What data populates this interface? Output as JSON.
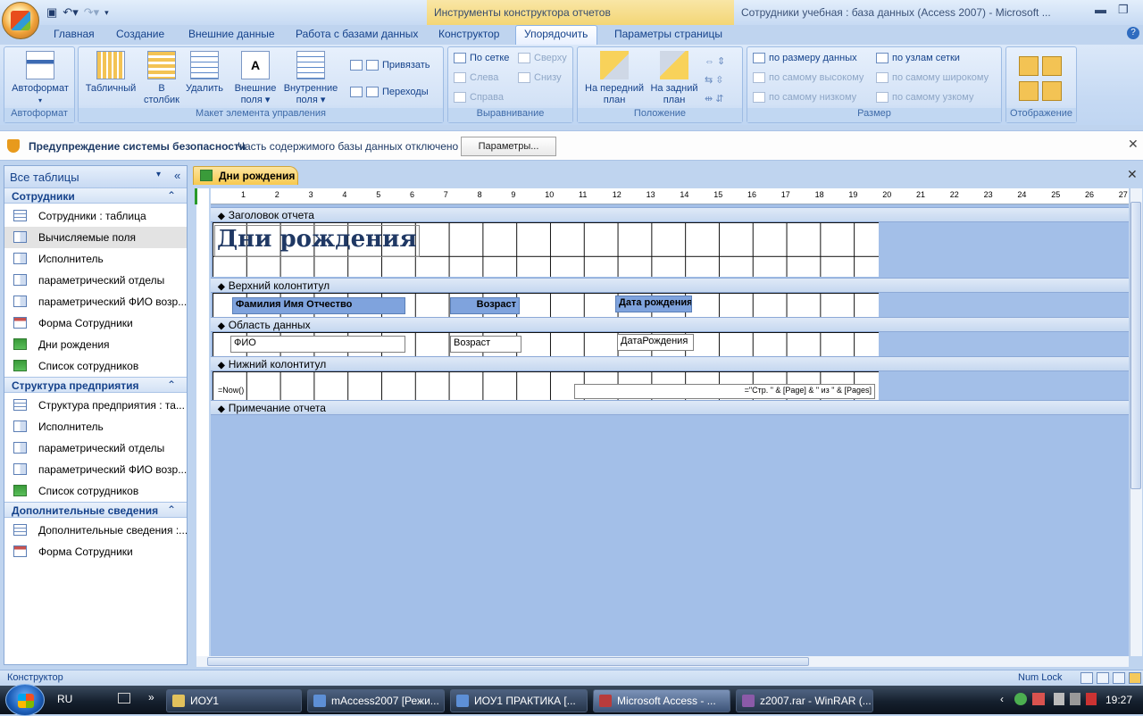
{
  "ribbon_context": "Инструменты конструктора отчетов",
  "window_title": "Сотрудники учебная : база данных (Access 2007) - Microsoft ...",
  "tabs": [
    "Главная",
    "Создание",
    "Внешние данные",
    "Работа с базами данных",
    "Конструктор",
    "Упорядочить",
    "Параметры страницы"
  ],
  "groups": {
    "autoformat": {
      "label": "Автоформат",
      "btn": "Автоформат"
    },
    "layout": {
      "label": "Макет элемента управления",
      "tabular": "Табличный",
      "stacked1": "В",
      "stacked2": "столбик",
      "remove": "Удалить",
      "outer1": "Внешние",
      "outer2": "поля",
      "inner1": "Внутренние",
      "inner2": "поля",
      "bind": "Привязать",
      "jumps": "Переходы"
    },
    "align": {
      "label": "Выравнивание",
      "grid": "По сетке",
      "top": "Сверху",
      "left": "Слева",
      "bottom": "Снизу",
      "right": "Справа"
    },
    "position": {
      "label": "Положение",
      "front1": "На передний",
      "front2": "план",
      "back1": "На задний",
      "back2": "план"
    },
    "size": {
      "label": "Размер",
      "fit": "по размеру данных",
      "to_grid": "по узлам сетки",
      "tallest": "по самому высокому",
      "widest": "по самому широкому",
      "shortest": "по самому низкому",
      "narrowest": "по самому узкому"
    },
    "show": {
      "label": "Отображение"
    }
  },
  "security": {
    "title": "Предупреждение системы безопасности",
    "text": "Часть содержимого базы данных отключено",
    "button": "Параметры..."
  },
  "nav": {
    "header": "Все таблицы",
    "sections": [
      {
        "title": "Сотрудники",
        "items": [
          "Сотрудники : таблица",
          "Вычисляемые поля",
          "Исполнитель",
          "параметрический отделы",
          "параметрический ФИО возр...",
          "Форма Сотрудники",
          "Дни рождения",
          "Список сотрудников"
        ]
      },
      {
        "title": "Структура предприятия",
        "items": [
          "Структура предприятия : та...",
          "Исполнитель",
          "параметрический отделы",
          "параметрический ФИО возр...",
          "Список сотрудников"
        ]
      },
      {
        "title": "Дополнительные сведения",
        "items": [
          "Дополнительные сведения :...",
          "Форма Сотрудники"
        ]
      }
    ]
  },
  "doc_tab": "Дни рождения",
  "ruler": [
    "1",
    "2",
    "3",
    "4",
    "5",
    "6",
    "7",
    "8",
    "9",
    "10",
    "11",
    "12",
    "13",
    "14",
    "15",
    "16",
    "17",
    "18",
    "19",
    "20",
    "21",
    "22",
    "23",
    "24",
    "25",
    "26",
    "27"
  ],
  "sections": {
    "report_header": "Заголовок отчета",
    "page_header": "Верхний колонтитул",
    "detail": "Область данных",
    "page_footer": "Нижний колонтитул",
    "report_footer": "Примечание отчета"
  },
  "controls": {
    "title": "Дни рождения",
    "lbl_fio": "Фамилия Имя Отчество",
    "lbl_age": "Возраст",
    "lbl_dob": "Дата рождения",
    "fld_fio": "ФИО",
    "fld_age": "Возраст",
    "fld_dob": "ДатаРождения",
    "now": "=Now()",
    "pages": "=\"Стр. \" & [Page] & \" из \" & [Pages]"
  },
  "status": {
    "mode": "Конструктор",
    "numlock": "Num Lock"
  },
  "taskbar": {
    "lang": "RU",
    "items": [
      "ИОУ1",
      "mAccess2007 [Режи...",
      "ИОУ1 ПРАКТИКА [...",
      "Microsoft Access - ...",
      "z2007.rar - WinRAR (..."
    ],
    "clock": "19:27"
  }
}
